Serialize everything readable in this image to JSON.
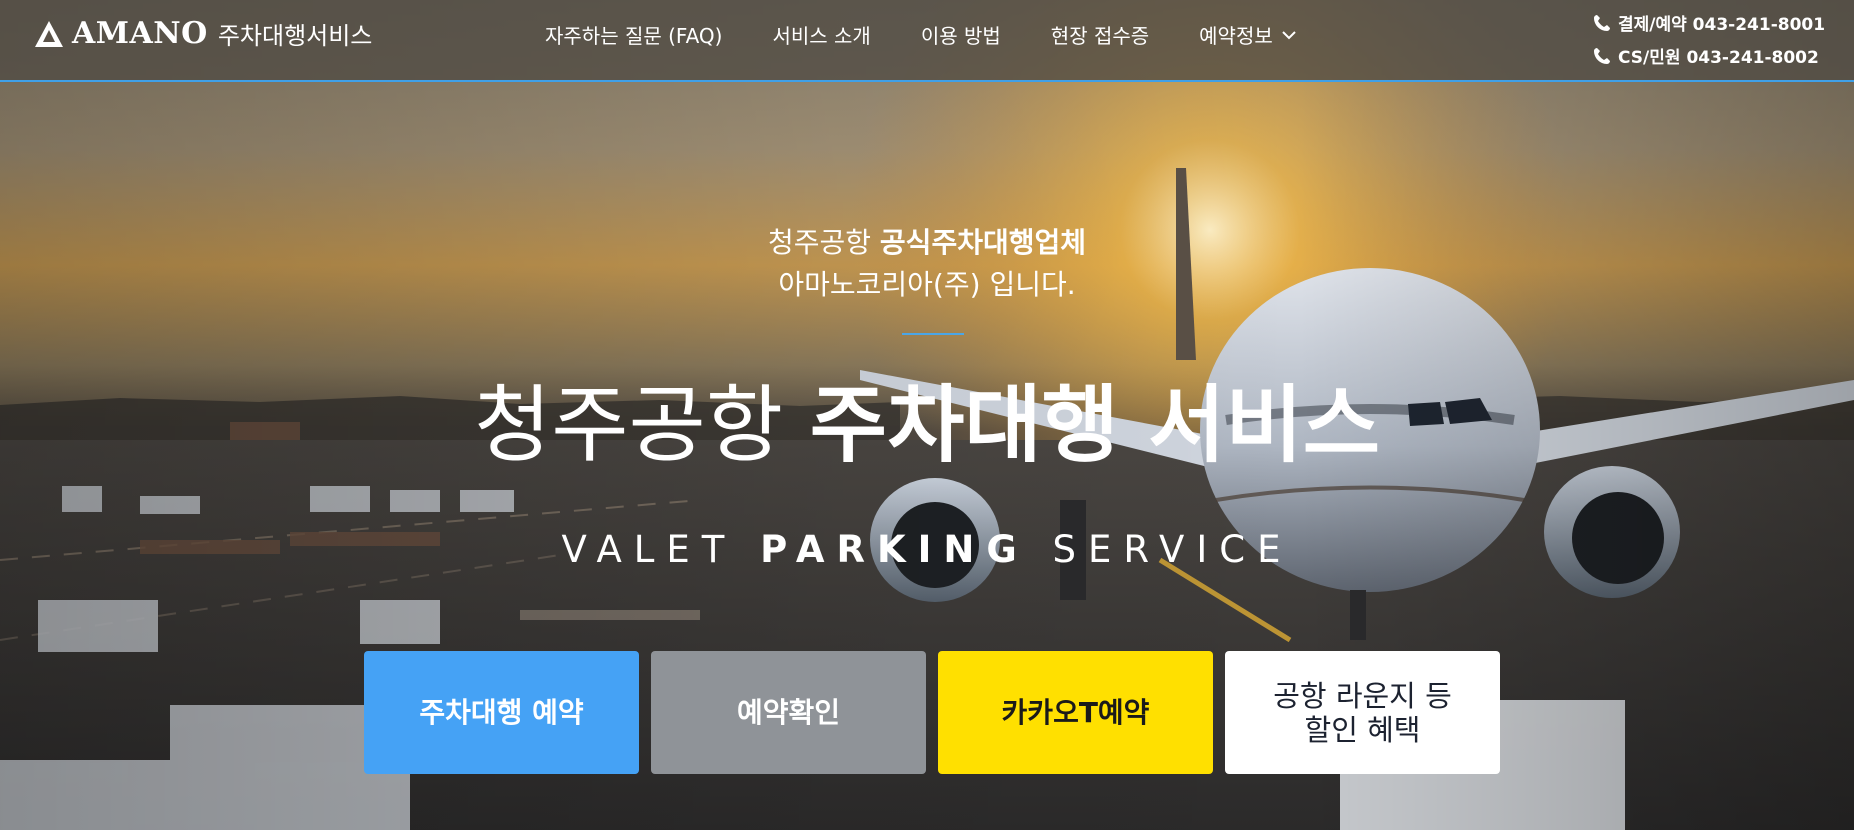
{
  "header": {
    "brand": "AMANO",
    "brand_sub": "주차대행서비스",
    "nav": [
      {
        "label": "자주하는 질문 (FAQ)"
      },
      {
        "label": "서비스 소개"
      },
      {
        "label": "이용 방법"
      },
      {
        "label": "현장 접수증"
      },
      {
        "label": "예약정보",
        "icon": "chevron-down-icon"
      }
    ],
    "contacts": [
      {
        "label": "결제/예약 043-241-8001",
        "icon": "phone-icon"
      },
      {
        "label": "CS/민원 043-241-8002",
        "icon": "phone-icon"
      }
    ],
    "accent_color": "#3fa0e8"
  },
  "hero": {
    "kicker_line1_normal": "청주공항 ",
    "kicker_line1_bold": "공식주차대행업체",
    "kicker_line2": "아마노코리아(주) 입니다.",
    "headline_normal": "청주공항 ",
    "headline_bold": "주차대행 서비스",
    "tagline_part1": "VALET ",
    "tagline_bold": "PARKING",
    "tagline_part2": " SERVICE"
  },
  "buttons": [
    {
      "label": "주차대행 예약",
      "color": "#45a2f5"
    },
    {
      "label": "예약확인",
      "color": "#8f9398"
    },
    {
      "label": "카카오T예약",
      "color": "#ffe000"
    },
    {
      "label_line1": "공항 라운지 등",
      "label_line2": "할인 혜택",
      "color": "#ffffff"
    }
  ]
}
